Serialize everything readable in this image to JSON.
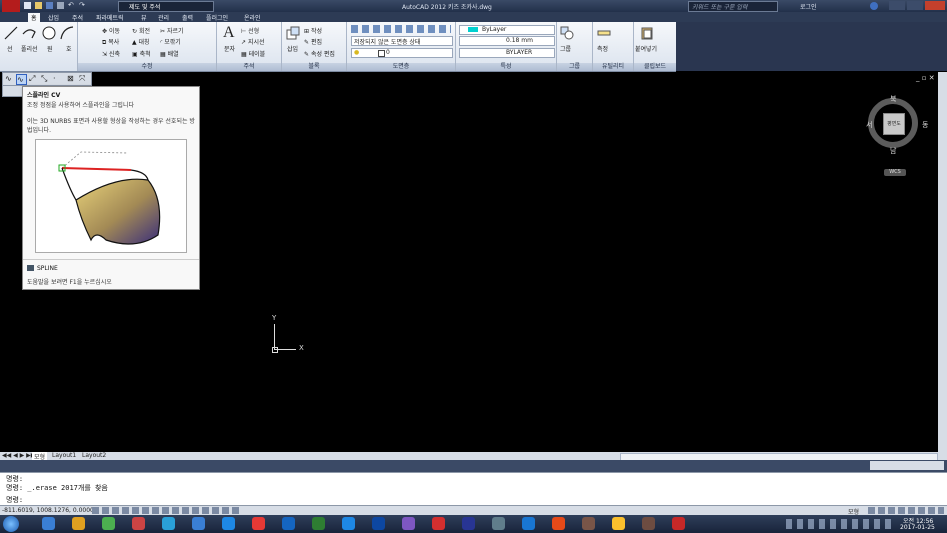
{
  "titlebar": {
    "workspace": "제도 및 주석",
    "title": "AutoCAD 2012    키즈 조카사.dwg",
    "search_placeholder": "키워드 또는 구문 입력",
    "signin": "로그인"
  },
  "ribbon_tabs": [
    "홈",
    "삽입",
    "주석",
    "파라메트릭",
    "뷰",
    "관리",
    "출력",
    "플러그인",
    "온라인"
  ],
  "ribbon": {
    "draw": {
      "line": "선",
      "polyline": "폴리선",
      "circle": "원",
      "arc": "호"
    },
    "modify": {
      "label": "수정",
      "move": "이동",
      "rotate": "회전",
      "trim": "자르기",
      "copy": "복사",
      "mirror": "대칭",
      "fillet": "모깎기",
      "stretch": "신축",
      "scale": "축척",
      "array": "배열"
    },
    "annotation": {
      "label": "주석",
      "text": "문자",
      "linear": "선형",
      "leader": "지시선",
      "table": "테이블"
    },
    "block": {
      "label": "블록",
      "insert": "삽입",
      "create": "작성",
      "edit": "편집",
      "edit_attr": "속성 편집"
    },
    "layers": {
      "label": "도면층",
      "state": "저장되지 않은 도면층 상태",
      "current": "0"
    },
    "properties": {
      "label": "특성",
      "color": "ByLayer",
      "lineweight": "0.18 mm",
      "linetype": "BYLAYER"
    },
    "groups": {
      "label": "그룹",
      "group": "그룹"
    },
    "utilities": {
      "label": "유틸리티",
      "measure": "측정"
    },
    "clipboard": {
      "label": "클립보드",
      "paste": "붙여넣기"
    }
  },
  "tooltip": {
    "title": "스플라인 CV",
    "desc": "조정 정점을 사용하여 스플라인을 그립니다",
    "detail": "이는 3D NURBS 표면과 사용할 형상을 작성하는 경우 선호되는 방법입니다.",
    "command": "SPLINE",
    "help": "도움말을 보려면 F1을 누르십시오"
  },
  "viewcube": {
    "north": "북",
    "south": "남",
    "west": "서",
    "east": "동",
    "face": "평면도",
    "wcs": "WCS"
  },
  "ucs": {
    "x": "X",
    "y": "Y"
  },
  "layout_tabs": [
    "모형",
    "Layout1",
    "Layout2"
  ],
  "command_lines": [
    "명령:",
    "명령: _.erase 2017개를 찾음",
    "명령:"
  ],
  "status": {
    "coords": "-811.6019, 1008.1276, 0.0000",
    "model": "모형"
  },
  "taskbar": {
    "time": "오전 12:56",
    "date": "2017-01-25"
  }
}
